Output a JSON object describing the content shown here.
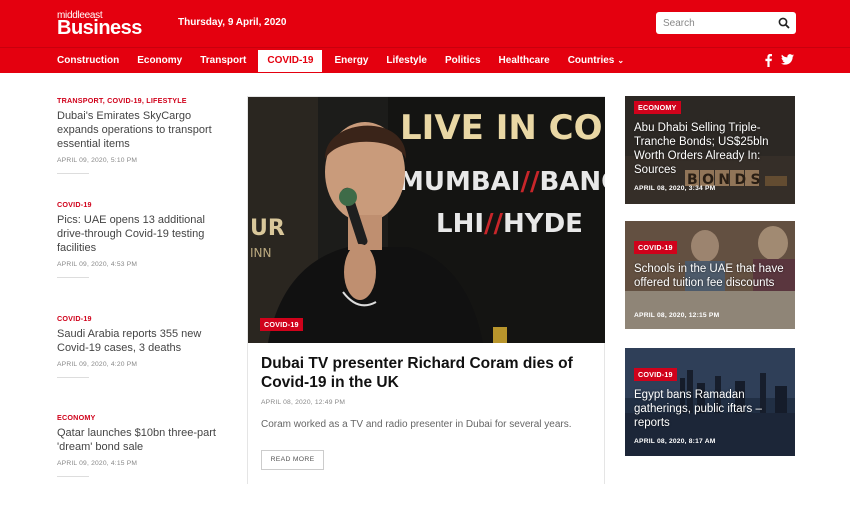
{
  "brand": {
    "small": "middleeast",
    "big": "Business"
  },
  "date": "Thursday, 9 April, 2020",
  "search": {
    "placeholder": "Search"
  },
  "nav": {
    "items": [
      "Construction",
      "Economy",
      "Transport",
      "COVID-19",
      "Energy",
      "Lifestyle",
      "Politics",
      "Healthcare",
      "Countries"
    ],
    "active": "COVID-19"
  },
  "social": [
    "facebook-icon",
    "twitter-icon"
  ],
  "left_stories": [
    {
      "tag": "TRANSPORT, COVID-19, LIFESTYLE",
      "title": "Dubai's Emirates SkyCargo expands operations to transport essential items",
      "date": "APRIL 09, 2020, 5:10 PM"
    },
    {
      "tag": "COVID-19",
      "title": "Pics: UAE opens 13 additional drive-through Covid-19 testing facilities",
      "date": "APRIL 09, 2020, 4:53 PM"
    },
    {
      "tag": "COVID-19",
      "title": "Saudi Arabia reports 355 new Covid-19 cases, 3 deaths",
      "date": "APRIL 09, 2020, 4:20 PM"
    },
    {
      "tag": "ECONOMY",
      "title": "Qatar launches $10bn three-part 'dream' bond sale",
      "date": "APRIL 09, 2020, 4:15 PM"
    }
  ],
  "feature": {
    "tag": "COVID-19",
    "title": "Dubai TV presenter Richard Coram dies of Covid-19 in the UK",
    "date": "APRIL 08, 2020, 12:49 PM",
    "desc": "Coram worked as a TV and radio presenter in Dubai for several years.",
    "button": "READ MORE",
    "banner_line1": "LIVE IN CON",
    "banner_line2a": "MUMBAI",
    "banner_line2b": "//",
    "banner_line2c": "BANG",
    "banner_line3a": "LHI",
    "banner_line3b": "//",
    "banner_line3c": "HYDE",
    "banner_side1": "UR",
    "banner_side2": "INN"
  },
  "right_cards": [
    {
      "tag": "ECONOMY",
      "title": "Abu Dhabi Selling Triple-Tranche Bonds; US$25bln Worth Orders Already In: Sources",
      "date": "APRIL 08, 2020, 3:34 PM",
      "blocks": "BONDS"
    },
    {
      "tag": "COVID-19",
      "title": "Schools in the UAE that have offered tuition fee discounts",
      "date": "APRIL 08, 2020, 12:15 PM"
    },
    {
      "tag": "COVID-19",
      "title": "Egypt bans Ramadan gatherings, public iftars – reports",
      "date": "APRIL 08, 2020, 8:17 AM"
    }
  ],
  "colors": {
    "brand_red": "#e4000f",
    "tag_red": "#d0021b"
  }
}
